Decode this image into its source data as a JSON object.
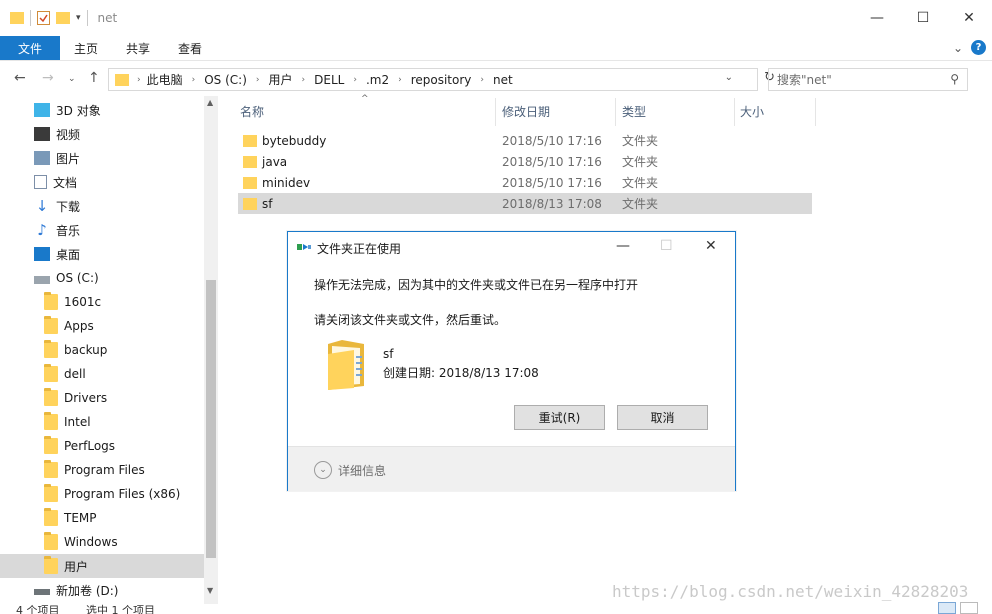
{
  "window": {
    "title": "net"
  },
  "window_controls": {
    "minimize": "—",
    "maximize": "☐",
    "close": "✕"
  },
  "ribbon": {
    "tabs": [
      {
        "label": "文件"
      },
      {
        "label": "主页"
      },
      {
        "label": "共享"
      },
      {
        "label": "查看"
      }
    ]
  },
  "address": {
    "crumbs": [
      "此电脑",
      "OS (C:)",
      "用户",
      "DELL",
      ".m2",
      "repository",
      "net"
    ]
  },
  "search": {
    "placeholder": "搜索\"net\""
  },
  "sidebar": {
    "items": [
      {
        "label": "3D 对象",
        "icon": "3d-objects-icon"
      },
      {
        "label": "视频",
        "icon": "video-icon"
      },
      {
        "label": "图片",
        "icon": "pictures-icon"
      },
      {
        "label": "文档",
        "icon": "documents-icon"
      },
      {
        "label": "下载",
        "icon": "download-icon"
      },
      {
        "label": "音乐",
        "icon": "music-icon"
      },
      {
        "label": "桌面",
        "icon": "desktop-icon"
      },
      {
        "label": "OS (C:)",
        "icon": "drive-icon"
      },
      {
        "label": "1601c",
        "icon": "folder-icon"
      },
      {
        "label": "Apps",
        "icon": "folder-icon"
      },
      {
        "label": "backup",
        "icon": "folder-icon"
      },
      {
        "label": "dell",
        "icon": "folder-icon"
      },
      {
        "label": "Drivers",
        "icon": "folder-icon"
      },
      {
        "label": "Intel",
        "icon": "folder-icon"
      },
      {
        "label": "PerfLogs",
        "icon": "folder-icon"
      },
      {
        "label": "Program Files",
        "icon": "folder-icon"
      },
      {
        "label": "Program Files (x86)",
        "icon": "folder-icon"
      },
      {
        "label": "TEMP",
        "icon": "folder-icon"
      },
      {
        "label": "Windows",
        "icon": "folder-icon"
      },
      {
        "label": "用户",
        "icon": "folder-icon",
        "selected": true
      },
      {
        "label": "新加卷 (D:)",
        "icon": "drive-icon"
      }
    ]
  },
  "columns": {
    "name": "名称",
    "modified": "修改日期",
    "type": "类型",
    "size": "大小"
  },
  "files": [
    {
      "name": "bytebuddy",
      "modified": "2018/5/10 17:16",
      "type": "文件夹"
    },
    {
      "name": "java",
      "modified": "2018/5/10 17:16",
      "type": "文件夹"
    },
    {
      "name": "minidev",
      "modified": "2018/5/10 17:16",
      "type": "文件夹"
    },
    {
      "name": "sf",
      "modified": "2018/8/13 17:08",
      "type": "文件夹",
      "selected": true
    }
  ],
  "status": {
    "item_count": "4 个项目",
    "selection": "选中 1 个项目"
  },
  "watermark": "https://blog.csdn.net/weixin_42828203",
  "dialog": {
    "title": "文件夹正在使用",
    "message": "操作无法完成，因为其中的文件夹或文件已在另一程序中打开",
    "instruction": "请关闭该文件夹或文件，然后重试。",
    "file_name": "sf",
    "created": "创建日期: 2018/8/13 17:08",
    "retry_label": "重试(R)",
    "cancel_label": "取消",
    "details_label": "详细信息"
  },
  "colors": {
    "accent": "#1979ca",
    "selection": "#d9d9d9",
    "folder": "#ffd35c"
  }
}
